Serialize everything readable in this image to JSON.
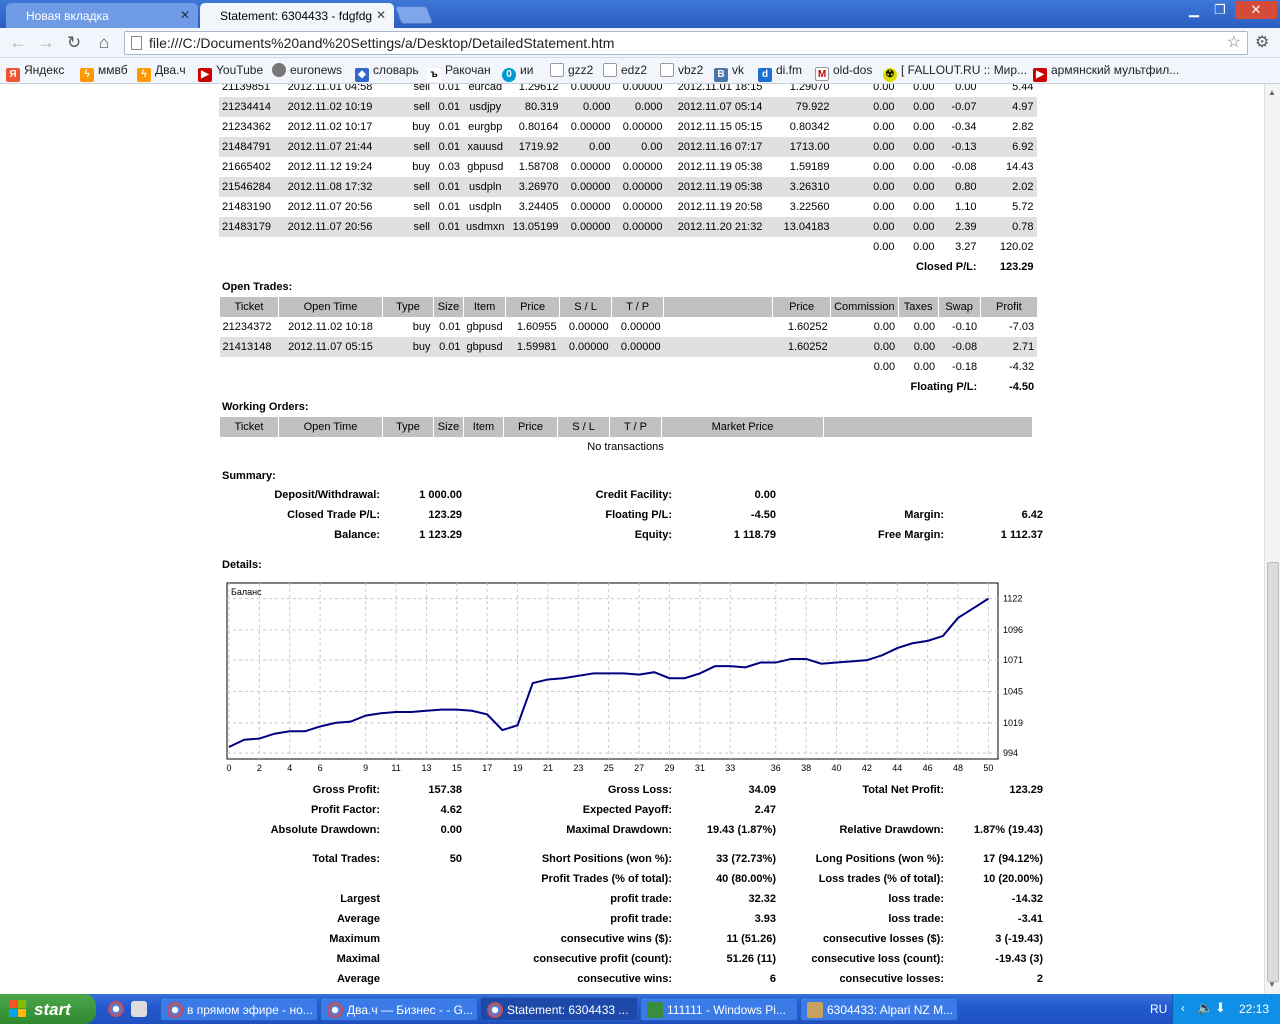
{
  "browser": {
    "tabs": [
      {
        "label": "Новая вкладка",
        "active": false
      },
      {
        "label": "Statement: 6304433 - fdgfdg",
        "active": true
      }
    ],
    "url": "file:///C:/Documents%20and%20Settings/a/Desktop/DetailedStatement.htm",
    "bookmarks": [
      "Яндекс",
      "ммвб",
      "Два.ч",
      "YouTube",
      "euronews",
      "словарь",
      "Ракочан",
      "ии",
      "gzz2",
      "edz2",
      "vbz2",
      "vk",
      "di.fm",
      "old-dos",
      "[ FALLOUT.RU :: Мир...",
      "армянский мультфил..."
    ]
  },
  "closed_rows": [
    [
      "21139851",
      "2012.11.01 04:58",
      "sell",
      "0.01",
      "eurcad",
      "1.29612",
      "0.00000",
      "0.00000",
      "2012.11.01 18:15",
      "1.29070",
      "0.00",
      "0.00",
      "0.00",
      "5.44"
    ],
    [
      "21234414",
      "2012.11.02 10:19",
      "sell",
      "0.01",
      "usdjpy",
      "80.319",
      "0.000",
      "0.000",
      "2012.11.07 05:14",
      "79.922",
      "0.00",
      "0.00",
      "-0.07",
      "4.97"
    ],
    [
      "21234362",
      "2012.11.02 10:17",
      "buy",
      "0.01",
      "eurgbp",
      "0.80164",
      "0.00000",
      "0.00000",
      "2012.11.15 05:15",
      "0.80342",
      "0.00",
      "0.00",
      "-0.34",
      "2.82"
    ],
    [
      "21484791",
      "2012.11.07 21:44",
      "sell",
      "0.01",
      "xauusd",
      "1719.92",
      "0.00",
      "0.00",
      "2012.11.16 07:17",
      "1713.00",
      "0.00",
      "0.00",
      "-0.13",
      "6.92"
    ],
    [
      "21665402",
      "2012.11.12 19:24",
      "buy",
      "0.03",
      "gbpusd",
      "1.58708",
      "0.00000",
      "0.00000",
      "2012.11.19 05:38",
      "1.59189",
      "0.00",
      "0.00",
      "-0.08",
      "14.43"
    ],
    [
      "21546284",
      "2012.11.08 17:32",
      "sell",
      "0.01",
      "usdpln",
      "3.26970",
      "0.00000",
      "0.00000",
      "2012.11.19 05:38",
      "3.26310",
      "0.00",
      "0.00",
      "0.80",
      "2.02"
    ],
    [
      "21483190",
      "2012.11.07 20:56",
      "sell",
      "0.01",
      "usdpln",
      "3.24405",
      "0.00000",
      "0.00000",
      "2012.11.19 20:58",
      "3.22560",
      "0.00",
      "0.00",
      "1.10",
      "5.72"
    ],
    [
      "21483179",
      "2012.11.07 20:56",
      "sell",
      "0.01",
      "usdmxn",
      "13.05199",
      "0.00000",
      "0.00000",
      "2012.11.20 21:32",
      "13.04183",
      "0.00",
      "0.00",
      "2.39",
      "0.78"
    ]
  ],
  "closed_totals": {
    "commission": "0.00",
    "taxes": "0.00",
    "swap": "3.27",
    "profit": "120.02",
    "pl_label": "Closed P/L:",
    "pl_value": "123.29"
  },
  "open_trades": {
    "title": "Open Trades:",
    "headers": [
      "Ticket",
      "Open Time",
      "Type",
      "Size",
      "Item",
      "Price",
      "S / L",
      "T / P",
      "",
      "Price",
      "Commission",
      "Taxes",
      "Swap",
      "Profit"
    ],
    "rows": [
      [
        "21234372",
        "2012.11.02 10:18",
        "buy",
        "0.01",
        "gbpusd",
        "1.60955",
        "0.00000",
        "0.00000",
        "",
        "1.60252",
        "0.00",
        "0.00",
        "-0.10",
        "-7.03"
      ],
      [
        "21413148",
        "2012.11.07 05:15",
        "buy",
        "0.01",
        "gbpusd",
        "1.59981",
        "0.00000",
        "0.00000",
        "",
        "1.60252",
        "0.00",
        "0.00",
        "-0.08",
        "2.71"
      ]
    ],
    "totals": {
      "commission": "0.00",
      "taxes": "0.00",
      "swap": "-0.18",
      "profit": "-4.32"
    },
    "pl_label": "Floating P/L:",
    "pl_value": "-4.50"
  },
  "working_orders": {
    "title": "Working Orders:",
    "headers": [
      "Ticket",
      "Open Time",
      "Type",
      "Size",
      "Item",
      "Price",
      "S / L",
      "T / P",
      "Market Price",
      ""
    ],
    "empty": "No transactions"
  },
  "summary": {
    "title": "Summary:",
    "deposit_label": "Deposit/Withdrawal:",
    "deposit": "1 000.00",
    "credit_label": "Credit Facility:",
    "credit": "0.00",
    "closed_label": "Closed Trade P/L:",
    "closed": "123.29",
    "floating_label": "Floating P/L:",
    "floating": "-4.50",
    "margin_label": "Margin:",
    "margin": "6.42",
    "balance_label": "Balance:",
    "balance": "1 123.29",
    "equity_label": "Equity:",
    "equity": "1 118.79",
    "free_label": "Free Margin:",
    "free": "1 112.37"
  },
  "details_title": "Details:",
  "chart_data": {
    "type": "line",
    "legend_label": "Баланс",
    "x_ticks": [
      0,
      2,
      4,
      6,
      9,
      11,
      13,
      15,
      17,
      19,
      21,
      23,
      25,
      27,
      29,
      31,
      33,
      36,
      38,
      40,
      42,
      44,
      46,
      48,
      50
    ],
    "y_ticks": [
      994,
      1019,
      1045,
      1071,
      1096,
      1122
    ],
    "xlim": [
      0,
      50.5
    ],
    "ylim": [
      994,
      1130
    ],
    "series": [
      {
        "x": [
          0,
          1,
          2,
          3,
          4,
          5,
          6,
          7,
          8,
          9,
          10,
          11,
          12,
          13,
          14,
          15,
          16,
          17,
          18,
          19,
          20,
          21,
          22,
          23,
          24,
          25,
          26,
          27,
          28,
          29,
          30,
          31,
          32,
          33,
          34,
          35,
          36,
          37,
          38,
          39,
          40,
          41,
          42,
          43,
          44,
          45,
          46,
          47,
          48,
          49,
          50
        ],
        "y": [
          999,
          1005,
          1006,
          1010,
          1012,
          1012,
          1016,
          1019,
          1020,
          1025,
          1027,
          1028,
          1028,
          1029,
          1030,
          1030,
          1029,
          1026,
          1013,
          1017,
          1052,
          1055,
          1056,
          1058,
          1060,
          1060,
          1060,
          1059,
          1061,
          1056,
          1056,
          1060,
          1066,
          1066,
          1065,
          1069,
          1069,
          1072,
          1072,
          1068,
          1069,
          1070,
          1071,
          1075,
          1081,
          1085,
          1087,
          1091,
          1106,
          1114,
          1122
        ]
      }
    ]
  },
  "stats": {
    "gross_profit_label": "Gross Profit:",
    "gross_profit": "157.38",
    "gross_loss_label": "Gross Loss:",
    "gross_loss": "34.09",
    "net_label": "Total Net Profit:",
    "net": "123.29",
    "pf_label": "Profit Factor:",
    "pf": "4.62",
    "ep_label": "Expected Payoff:",
    "ep": "2.47",
    "abs_dd_label": "Absolute Drawdown:",
    "abs_dd": "0.00",
    "max_dd_label": "Maximal Drawdown:",
    "max_dd": "19.43 (1.87%)",
    "rel_dd_label": "Relative Drawdown:",
    "rel_dd": "1.87% (19.43)",
    "total_label": "Total Trades:",
    "total": "50",
    "short_label": "Short Positions (won %):",
    "short": "33 (72.73%)",
    "long_label": "Long Positions (won %):",
    "long": "17 (94.12%)",
    "pt_label": "Profit Trades (% of total):",
    "pt": "40 (80.00%)",
    "lt_label": "Loss trades (% of total):",
    "lt": "10 (20.00%)",
    "largest": "Largest",
    "largest_p_label": "profit trade:",
    "largest_p": "32.32",
    "largest_l_label": "loss trade:",
    "largest_l": "-14.32",
    "average": "Average",
    "avg_p_label": "profit trade:",
    "avg_p": "3.93",
    "avg_l_label": "loss trade:",
    "avg_l": "-3.41",
    "maximum": "Maximum",
    "max_w_label": "consecutive wins ($):",
    "max_w": "11 (51.26)",
    "max_l_label": "consecutive losses ($):",
    "max_l": "3 (-19.43)",
    "maximal": "Maximal",
    "mxl_p_label": "consecutive profit (count):",
    "mxl_p": "51.26 (11)",
    "mxl_l_label": "consecutive loss (count):",
    "mxl_l": "-19.43 (3)",
    "average2": "Average",
    "av_w_label": "consecutive wins:",
    "av_w": "6",
    "av_l_label": "consecutive losses:",
    "av_l": "2"
  },
  "taskbar": {
    "start": "start",
    "items": [
      "в прямом эфире - но...",
      "Два.ч — Бизнес - - G...",
      "Statement: 6304433 ...",
      "111111 - Windows Pi...",
      "6304433: Alpari NZ M..."
    ],
    "lang": "RU",
    "clock": "22:13"
  }
}
